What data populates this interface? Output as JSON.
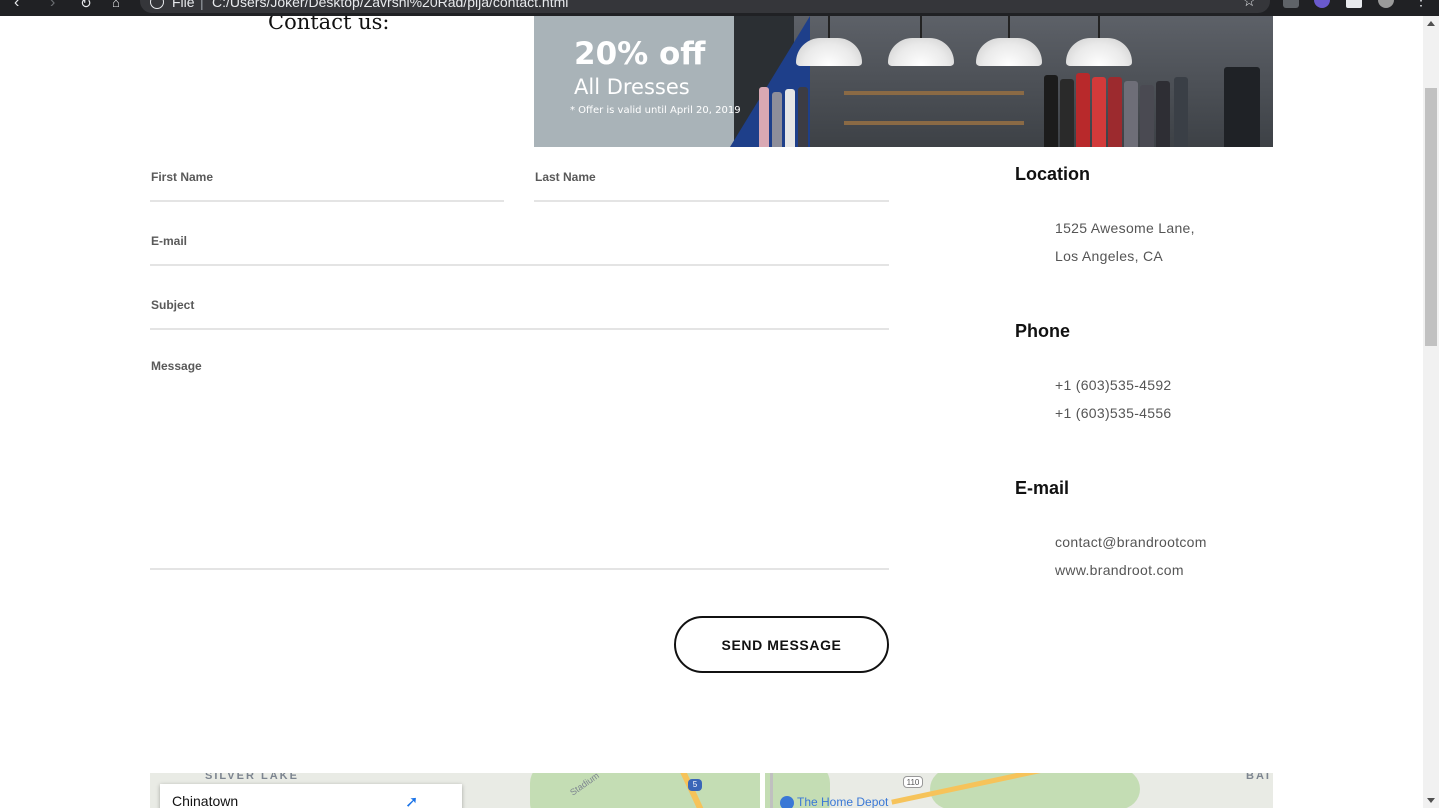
{
  "browser": {
    "scheme": "File",
    "url": "C:/Users/Joker/Desktop/Zavrsni%20Rad/pija/contact.html",
    "star_icon": "star-icon",
    "colors": {
      "chrome_bg": "#202124",
      "address_bg": "#35363a"
    }
  },
  "page": {
    "title": "Contact us:",
    "banner": {
      "headline": "20% off",
      "subline": "All Dresses",
      "note": "* Offer is valid until April 20, 2019"
    }
  },
  "form": {
    "first_name_label": "First Name",
    "last_name_label": "Last Name",
    "email_label": "E-mail",
    "subject_label": "Subject",
    "message_label": "Message",
    "first_name_value": "",
    "last_name_value": "",
    "email_value": "",
    "subject_value": "",
    "message_value": "",
    "submit_label": "SEND MESSAGE"
  },
  "info": {
    "location_heading": "Location",
    "address_line1": "1525 Awesome Lane,",
    "address_line2": "Los Angeles, CA",
    "phone_heading": "Phone",
    "phone1": "+1 (603)535-4592",
    "phone2": "+1 (603)535-4556",
    "email_heading": "E-mail",
    "email": "contact@brandrootcom",
    "website": "www.brandroot.com"
  },
  "map": {
    "area_label_left": "SILVER LAKE",
    "area_label_right": "BAI",
    "street_label": "Stadium",
    "highway1": "5",
    "highway2": "110",
    "poi": "The Home Depot",
    "card_place": "Chinatown",
    "card_icon": "directions-icon"
  }
}
